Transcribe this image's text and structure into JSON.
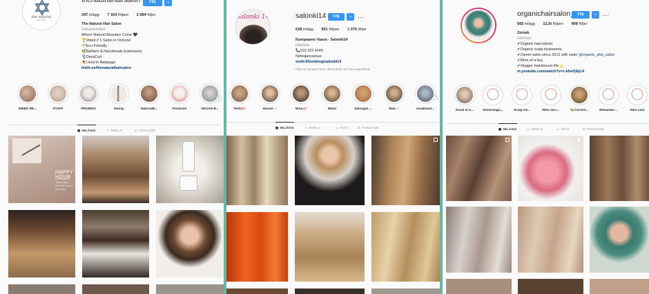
{
  "p1": {
    "username": "thenaturalhairsalon",
    "logo_line1": "the natural",
    "logo_line2": "hair salon",
    "follow": "Följ",
    "stats": {
      "posts": "347",
      "posts_label": "inlägg",
      "followers": "7 154",
      "followers_label": "följare",
      "following": "2 894",
      "following_label": "följer"
    },
    "bio": {
      "name": "The Natural Hair Salon",
      "category": "Hälsa/skönhet",
      "lines": [
        "Where Natural Beauties Come 🖤",
        "🏆Voted # 1 Salon in Victoria!",
        "🌱Eco-Friendly",
        "🌿Balliami & Nanobeads Extensions",
        "🌪DevaCurl",
        "🌻Lived in Balayage"
      ],
      "link": "linktr.ee/thenaturalhairsalon"
    },
    "highlights": [
      "WEEK RE...",
      "STAFF",
      "PROMOS",
      "Hiring",
      "NaturalB...",
      "Products",
      "VEGAN B..."
    ],
    "tabs": [
      "INLÄGG",
      "REELS",
      "TAGGADE"
    ],
    "post_text": {
      "title": "HAPPY HOUR",
      "line1": "Tuesdays & Thursdays",
      "line2": "20% off colour services"
    }
  },
  "p2": {
    "username": "salonki14",
    "logo_text": "Salonki 14",
    "follow": "Följ",
    "more": "···",
    "stats": {
      "posts": "628",
      "posts_label": "inlägg",
      "followers": "951",
      "followers_label": "följare",
      "following": "1 076",
      "following_label": "följer"
    },
    "bio": {
      "name": "Kampaamo Vaasa - Salonki14",
      "category": "Hårfrisör",
      "phone": "📞010 322 4240",
      "booking": "Nettiajanvaraus:",
      "link": "slotti.fi/booking/salonki14"
    },
    "followed_by": "Följs av saragunmarie, ldamiranda och mimosapoikkala",
    "highlights": [
      "Tertti💯",
      "Hanne🤍",
      "Nina💯",
      "Malin",
      "Salongin ...",
      "Mila🤍",
      "Asiakkaat..."
    ],
    "tabs": [
      "INLÄGG",
      "REELS",
      "IGTV",
      "TAGGADE"
    ]
  },
  "p3": {
    "username": "organichairsalon_",
    "follow": "Följ",
    "more": "···",
    "stats": {
      "posts": "682",
      "posts_label": "inlägg",
      "followers": "12,5t",
      "followers_label": "följare",
      "following": "908",
      "following_label": "följer"
    },
    "bio": {
      "name": "Zeinab",
      "category": "Hårfrisör",
      "l1": "✔Organic haircolorist",
      "l2": "✔Organic scalp treatments",
      "l3a": "✔Owner salon since 2012 with sister ",
      "l3b": "@organic_skin_salon",
      "l4": "✔Mom of a boy",
      "l5": "✔Vlogger hairdresser life💫",
      "link": "m.youtube.com/watch?v=c-kheOjkjLA"
    },
    "highlights": [
      "Good to k...",
      "Klournings...",
      "Scalp tre...",
      "Who am I...",
      "🌿Correct...",
      "Rebuildin...",
      "Skin care"
    ],
    "tabs": [
      "INLÄGG",
      "REELS",
      "IGTV",
      "TAGGADE"
    ]
  },
  "colors": {
    "follow_blue": "#3797f0",
    "divider_teal": "#5fb8a8",
    "link_blue": "#00376b"
  }
}
